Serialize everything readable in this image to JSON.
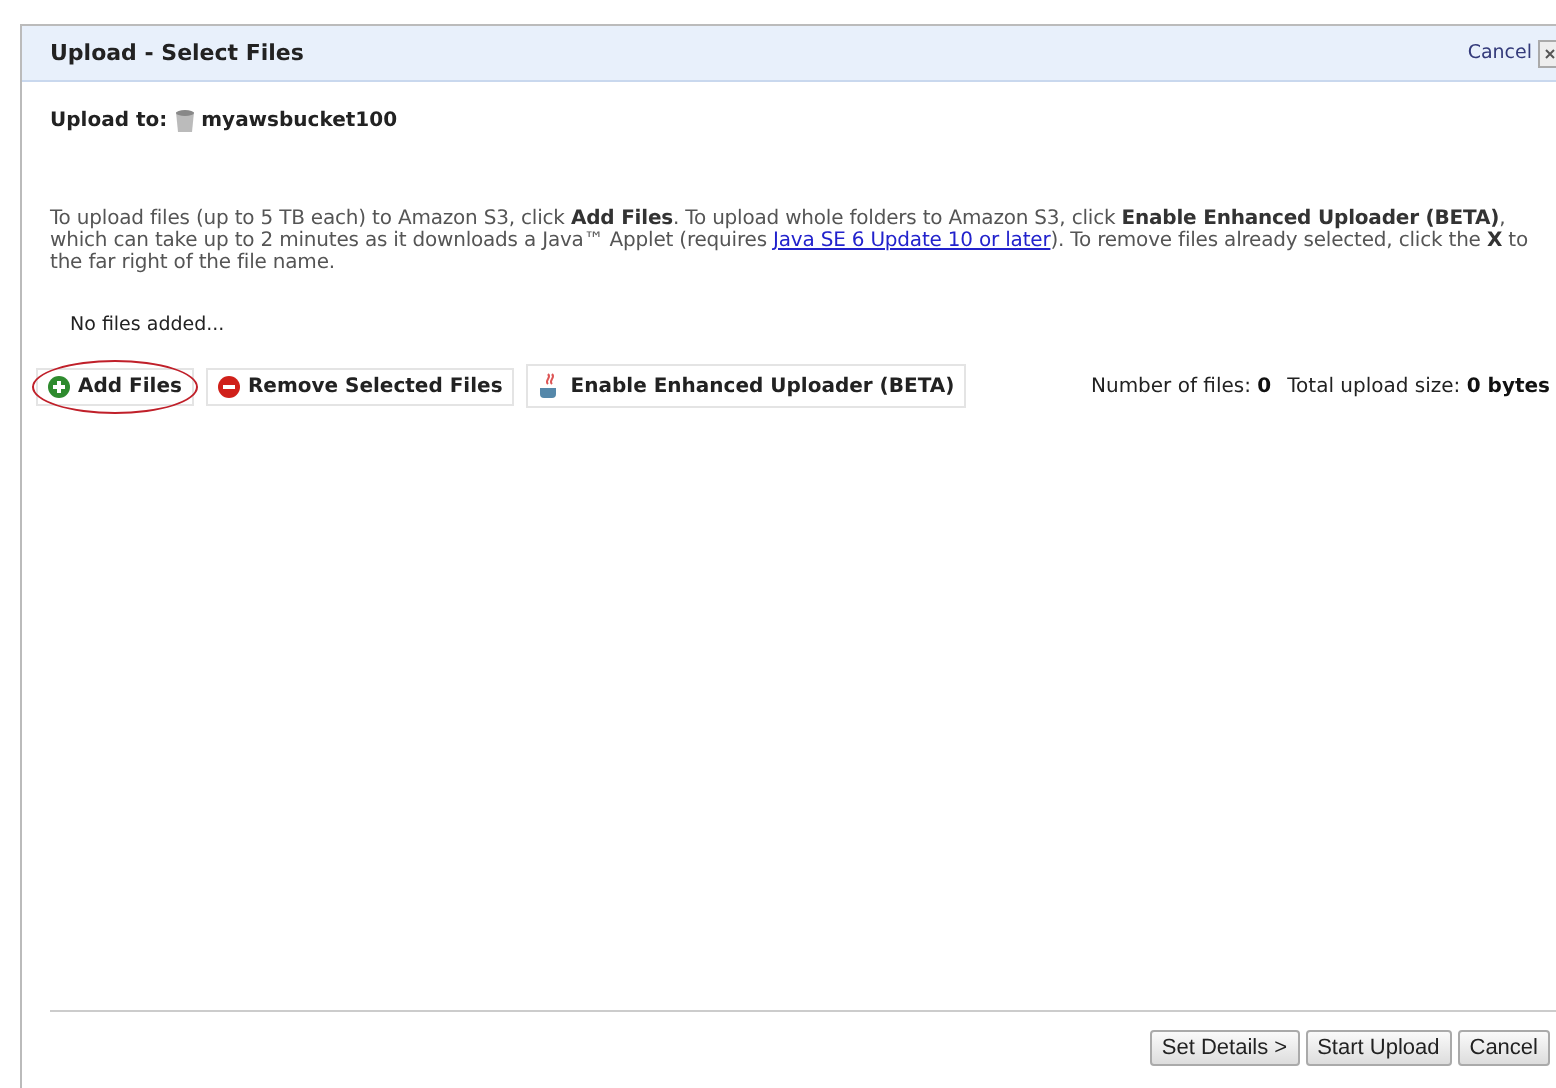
{
  "window": {
    "title": "Upload - Select Files",
    "cancel_link": "Cancel"
  },
  "upload_to": {
    "label": "Upload to:",
    "bucket": "myawsbucket100"
  },
  "description": {
    "before": "To upload files (up to 5 TB each) to Amazon S3, click **Add Files**. To upload whole folders to Amazon S3, click **Enable Enhanced Uploader (BETA)**, which can take up to 2 minutes as it downloads a Java™ Applet (requires ",
    "link": "Java SE 6 Update 10 or later",
    "after": "). To remove files already selected, click the **X** to the far right of the file name."
  },
  "file_list": {
    "empty_text": "No files added..."
  },
  "toolbar": [
    {
      "kind": "add",
      "label": "Add Files",
      "highlighted": true
    },
    {
      "kind": "remove",
      "label": "Remove Selected Files",
      "highlighted": false
    },
    {
      "kind": "java",
      "label": "Enable Enhanced Uploader (BETA)",
      "highlighted": false
    }
  ],
  "stats": [
    {
      "label": "Number of files:",
      "value": "0"
    },
    {
      "label": "Total upload size:",
      "value": "0 bytes"
    }
  ],
  "buttons": [
    "Set Details >",
    "Start Upload",
    "Cancel"
  ]
}
